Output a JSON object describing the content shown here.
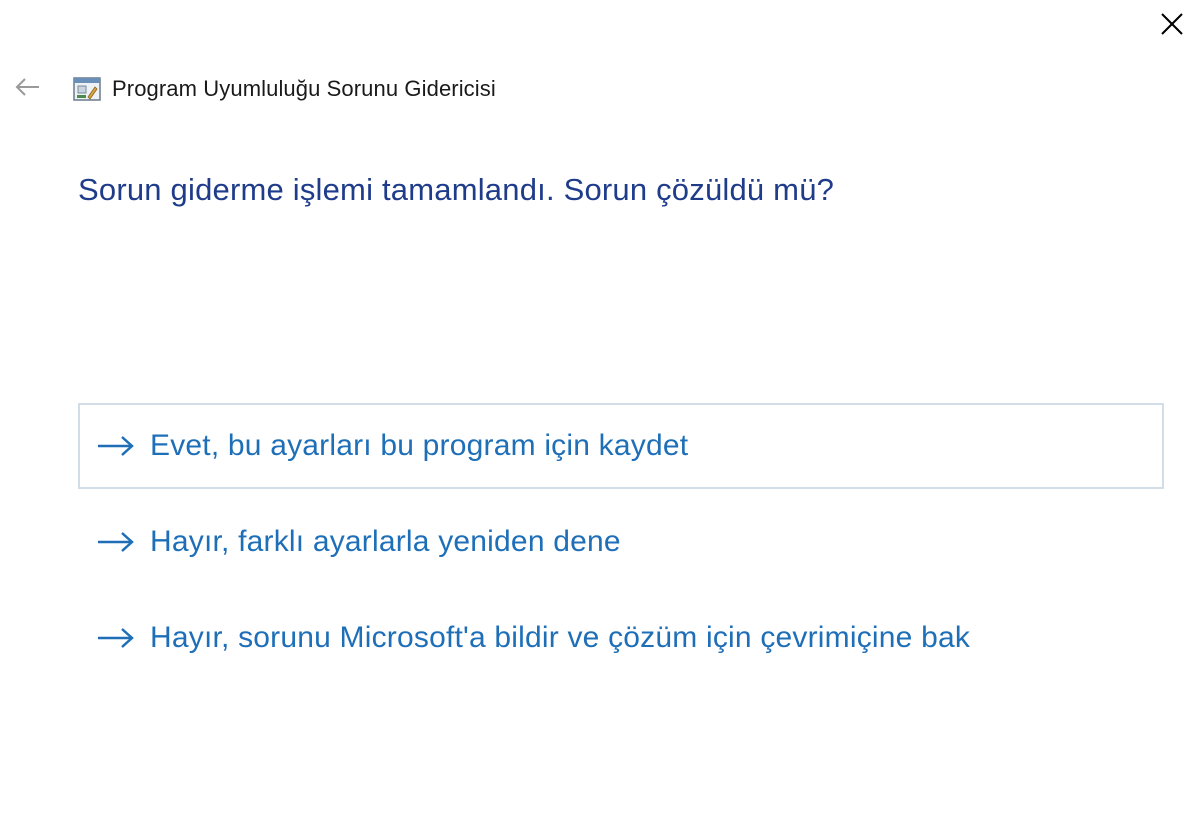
{
  "window": {
    "close_icon": "close-icon",
    "back_icon": "back-arrow-icon",
    "app_icon": "troubleshooter-icon",
    "title": "Program Uyumluluğu Sorunu Gidericisi"
  },
  "main": {
    "heading": "Sorun giderme işlemi tamamlandı. Sorun çözüldü mü?",
    "options": [
      {
        "label": "Evet, bu ayarları bu program için kaydet",
        "focused": true
      },
      {
        "label": "Hayır, farklı ayarlarla yeniden dene",
        "focused": false
      },
      {
        "label": "Hayır, sorunu Microsoft'a bildir ve çözüm için çevrimiçine bak",
        "focused": false
      }
    ]
  },
  "colors": {
    "heading": "#1f3c8b",
    "link": "#1e6fb8",
    "focus_border": "#d3dde8"
  }
}
